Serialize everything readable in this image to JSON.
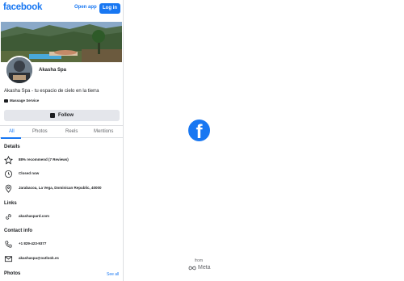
{
  "header": {
    "logo": "facebook",
    "open_app": "Open app",
    "login": "Log in"
  },
  "profile": {
    "name": "Akasha Spa",
    "bio": "Akasha Spa - tu espacio de cielo en la tierra",
    "category": "Massage Service",
    "follow_label": "Follow"
  },
  "tabs": [
    {
      "label": "All",
      "active": true
    },
    {
      "label": "Photos"
    },
    {
      "label": "Reels"
    },
    {
      "label": "Mentions"
    }
  ],
  "details": {
    "title": "Details",
    "recommend": "88% recommend (7 Reviews)",
    "hours": "Closed now",
    "address": "Jarabacoa, La Vega, Dominican Republic, 40000"
  },
  "links": {
    "title": "Links",
    "website": "akashaspard.com"
  },
  "contact": {
    "title": "Contact info",
    "phone": "+1 829-423-9377",
    "email": "akashaspa@outlook.es"
  },
  "photos": {
    "title": "Photos",
    "see_all": "See all"
  },
  "splash": {
    "from": "from",
    "meta": "Meta"
  },
  "colors": {
    "brand": "#1877f2",
    "text": "#1c1e21",
    "muted": "#65676b"
  }
}
